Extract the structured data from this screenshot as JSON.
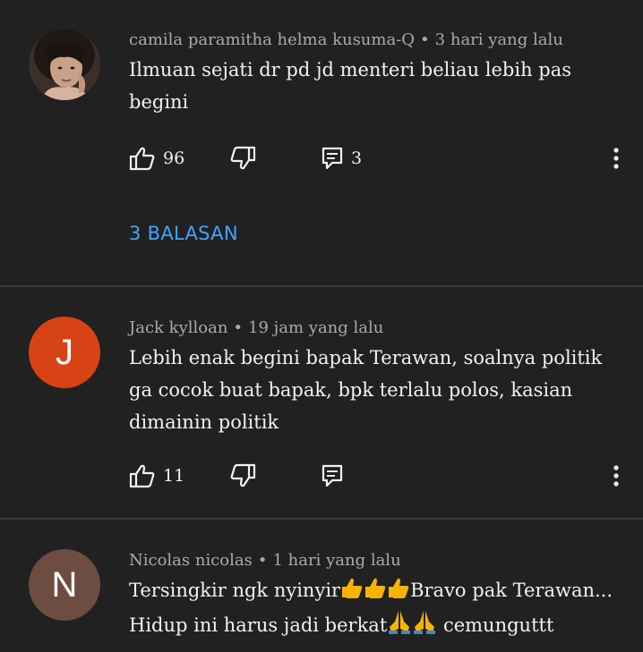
{
  "colors": {
    "background": "#212121",
    "text_primary": "#f1f1f1",
    "text_secondary": "#aaaaaa",
    "link_blue": "#3ea6ff",
    "divider": "#3a3a3a",
    "avatar_j": "#d84315",
    "avatar_n": "#6d4c41"
  },
  "comments": [
    {
      "author": "camila paramitha helma kusuma-Q",
      "separator": "•",
      "time": "3 hari yang lalu",
      "text": "Ilmuan sejati dr pd jd menteri beliau lebih pas begini",
      "likes": "96",
      "replies_count": "3",
      "replies_label": "3 BALASAN",
      "avatar": "photo"
    },
    {
      "author": "Jack kylloan",
      "separator": "•",
      "time": "19 jam yang lalu",
      "text": "Lebih enak begini bapak Terawan, soalnya politik ga cocok buat bapak, bpk terlalu polos, kasian dimainin politik",
      "likes": "11",
      "avatar_letter": "J"
    },
    {
      "author": "Nicolas nicolas",
      "separator": "•",
      "time": "1 hari yang lalu",
      "text_part1": "Tersingkir ngk nyinyir",
      "text_part2": "Bravo pak Terawan...",
      "text_part3": "Hidup ini harus jadi berkat",
      "text_part4": " cemunguttt",
      "avatar_letter": "N"
    }
  ],
  "icons": {
    "like": "thumbs-up-icon",
    "dislike": "thumbs-down-icon",
    "reply": "comment-icon",
    "more": "more-vert-icon",
    "emoji_thumb": "thumbs-up-emoji",
    "emoji_pray": "folded-hands-emoji"
  }
}
